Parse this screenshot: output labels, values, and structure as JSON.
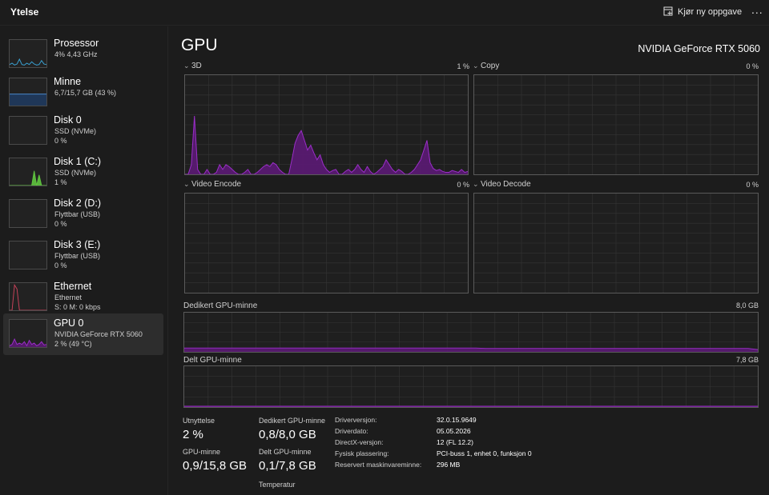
{
  "header": {
    "title": "Ytelse",
    "run_task_label": "Kjør ny oppgave",
    "more_label": "..."
  },
  "sidebar": {
    "items": [
      {
        "name": "Prosessor",
        "line1": "4% 4,43 GHz",
        "line2": ""
      },
      {
        "name": "Minne",
        "line1": "6,7/15,7 GB (43 %)",
        "line2": ""
      },
      {
        "name": "Disk 0",
        "line1": "SSD (NVMe)",
        "line2": "0 %"
      },
      {
        "name": "Disk 1 (C:)",
        "line1": "SSD (NVMe)",
        "line2": "1 %"
      },
      {
        "name": "Disk 2 (D:)",
        "line1": "Flyttbar (USB)",
        "line2": "0 %"
      },
      {
        "name": "Disk 3 (E:)",
        "line1": "Flyttbar (USB)",
        "line2": "0 %"
      },
      {
        "name": "Ethernet",
        "line1": "Ethernet",
        "line2": "S: 0 M: 0 kbps"
      },
      {
        "name": "GPU 0",
        "line1": "NVIDIA GeForce RTX 5060",
        "line2": "2 % (49 °C)"
      }
    ],
    "selected_index": 7
  },
  "main": {
    "title": "GPU",
    "model": "NVIDIA GeForce RTX 5060",
    "engines": [
      {
        "label": "3D",
        "value": "1 %"
      },
      {
        "label": "Copy",
        "value": "0 %"
      },
      {
        "label": "Video Encode",
        "value": "0 %"
      },
      {
        "label": "Video Decode",
        "value": "0 %"
      }
    ],
    "dedicated_memory": {
      "label": "Dedikert GPU-minne",
      "value": "8,0 GB"
    },
    "shared_memory": {
      "label": "Delt GPU-minne",
      "value": "7,8 GB"
    }
  },
  "stats": {
    "utilization_label": "Utnyttelse",
    "utilization_value": "2 %",
    "gpu_memory_label": "GPU-minne",
    "gpu_memory_value": "0,9/15,8 GB",
    "dedicated_label": "Dedikert GPU-minne",
    "dedicated_value": "0,8/8,0 GB",
    "shared_label": "Delt GPU-minne",
    "shared_value": "0,1/7,8 GB",
    "temperature_label": "Temperatur",
    "driver_version_label": "Driverversjon:",
    "driver_version_value": "32.0.15.9649",
    "driver_date_label": "Driverdato:",
    "driver_date_value": "05.05.2026",
    "directx_label": "DirectX-versjon:",
    "directx_value": "12 (FL 12.2)",
    "physical_location_label": "Fysisk plassering:",
    "physical_location_value": "PCI-buss 1, enhet 0, funksjon 0",
    "reserved_memory_label": "Reservert maskinvareminne:",
    "reserved_memory_value": "296 MB"
  },
  "colors": {
    "gpu_line": "#9b2ec9",
    "gpu_fill": "#5b1a74",
    "cpu_line": "#3aa5d8",
    "memory_line": "#4a86c8",
    "memory_fill": "#1f3a5e",
    "disk_line": "#5fc43f",
    "ethernet_line": "#c9425a",
    "grid": "#353535"
  },
  "series": {
    "gpu_3d": [
      0,
      0,
      0.1,
      0.6,
      0.05,
      0,
      0,
      0.05,
      0,
      0,
      0.02,
      0.1,
      0.05,
      0.1,
      0.08,
      0.05,
      0.02,
      0,
      0,
      0.02,
      0.05,
      0,
      0,
      0.02,
      0.05,
      0.08,
      0.1,
      0.08,
      0.12,
      0.1,
      0.05,
      0.02,
      0,
      0,
      0.15,
      0.32,
      0.4,
      0.45,
      0.35,
      0.25,
      0.3,
      0.22,
      0.15,
      0.2,
      0.1,
      0.05,
      0.02,
      0.04,
      0.05,
      0,
      0,
      0.03,
      0.05,
      0.02,
      0.05,
      0.1,
      0.05,
      0.02,
      0.08,
      0.03,
      0,
      0.02,
      0.05,
      0.08,
      0.15,
      0.1,
      0.05,
      0.02,
      0.05,
      0.03,
      0,
      0,
      0.02,
      0.05,
      0.1,
      0.15,
      0.25,
      0.35,
      0.12,
      0.06,
      0.04,
      0.05,
      0.03,
      0.02,
      0.02,
      0.04,
      0.03,
      0.02,
      0.05,
      0.02,
      0.03
    ],
    "sidebar_cpu": [
      0.1,
      0.15,
      0.08,
      0.12,
      0.3,
      0.1,
      0.08,
      0.15,
      0.1,
      0.2,
      0.12,
      0.08,
      0.1,
      0.25,
      0.12,
      0.1
    ],
    "sidebar_gpu": [
      0.05,
      0.1,
      0.3,
      0.1,
      0.15,
      0.1,
      0.2,
      0.05,
      0.25,
      0.1,
      0.15,
      0.05,
      0.1,
      0.2,
      0.08,
      0.1
    ],
    "sidebar_disk1": [
      0,
      0,
      0,
      0,
      0,
      0,
      0,
      0,
      0,
      0,
      0.55,
      0,
      0.4,
      0,
      0,
      0
    ],
    "sidebar_memory": [
      0.43,
      0.43,
      0.43,
      0.43,
      0.43,
      0.43,
      0.43,
      0.43,
      0.43,
      0.43,
      0.43,
      0.43,
      0.43,
      0.43,
      0.43,
      0.43
    ],
    "sidebar_ethernet": [
      0,
      0,
      0.95,
      0.8,
      0,
      0,
      0,
      0,
      0,
      0,
      0,
      0,
      0,
      0,
      0,
      0
    ],
    "dedicated_usage": [
      0.1,
      0.1,
      0.1,
      0.1,
      0.1,
      0.1,
      0.1,
      0.1,
      0.1,
      0.1,
      0.1,
      0.1,
      0.1,
      0.1,
      0.1,
      0.1,
      0.1,
      0.1,
      0.1,
      0.1,
      0.1,
      0.1,
      0.1,
      0.1,
      0.1,
      0.1,
      0.1,
      0.1,
      0.1,
      0.1,
      0.1,
      0.09,
      0.09,
      0.09,
      0.09,
      0.09,
      0.09,
      0.09,
      0.09,
      0.09,
      0.09,
      0.09,
      0.09,
      0.09,
      0.09,
      0.09,
      0.09,
      0.09,
      0.09,
      0.09,
      0.09,
      0.09,
      0.09,
      0.09,
      0.09,
      0.09,
      0.09,
      0.09,
      0.09,
      0.06
    ],
    "shared_usage": [
      0.02,
      0.02,
      0.02,
      0.02,
      0.02,
      0.02,
      0.02,
      0.02,
      0.02,
      0.02,
      0.02,
      0.02,
      0.02,
      0.02,
      0.02,
      0.02,
      0.02,
      0.02,
      0.02,
      0.02
    ]
  }
}
